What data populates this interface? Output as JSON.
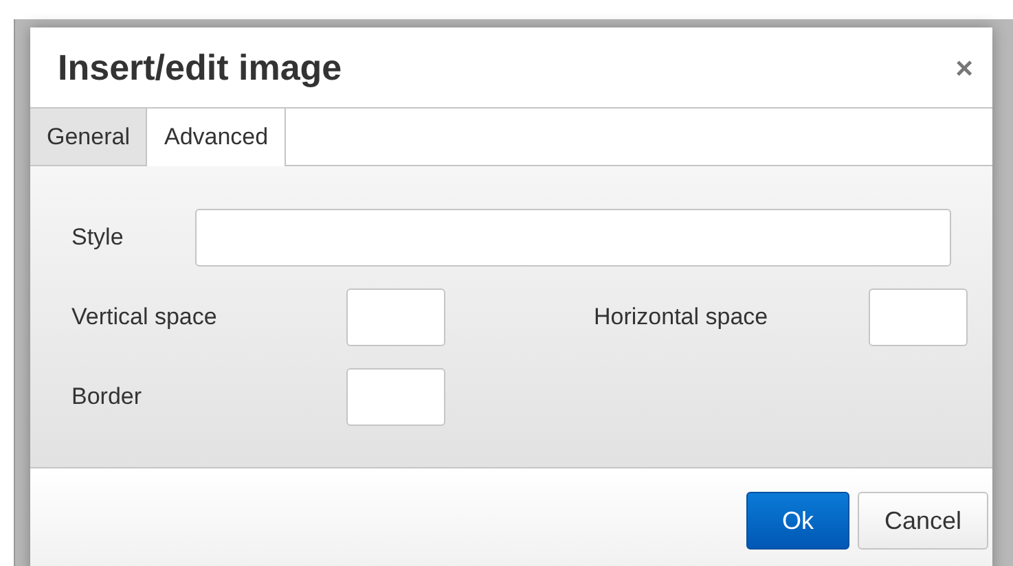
{
  "dialog": {
    "title": "Insert/edit image",
    "close": "×",
    "tabs": [
      {
        "label": "General",
        "selected": false
      },
      {
        "label": "Advanced",
        "selected": true
      }
    ],
    "fields": {
      "style": {
        "label": "Style"
      },
      "vertical_space": {
        "label": "Vertical space"
      },
      "horizontal_space": {
        "label": "Horizontal space"
      },
      "border": {
        "label": "Border"
      }
    },
    "buttons": [
      {
        "label": "Ok",
        "kind": "primary"
      },
      {
        "label": "Cancel",
        "kind": "secondary"
      }
    ]
  }
}
